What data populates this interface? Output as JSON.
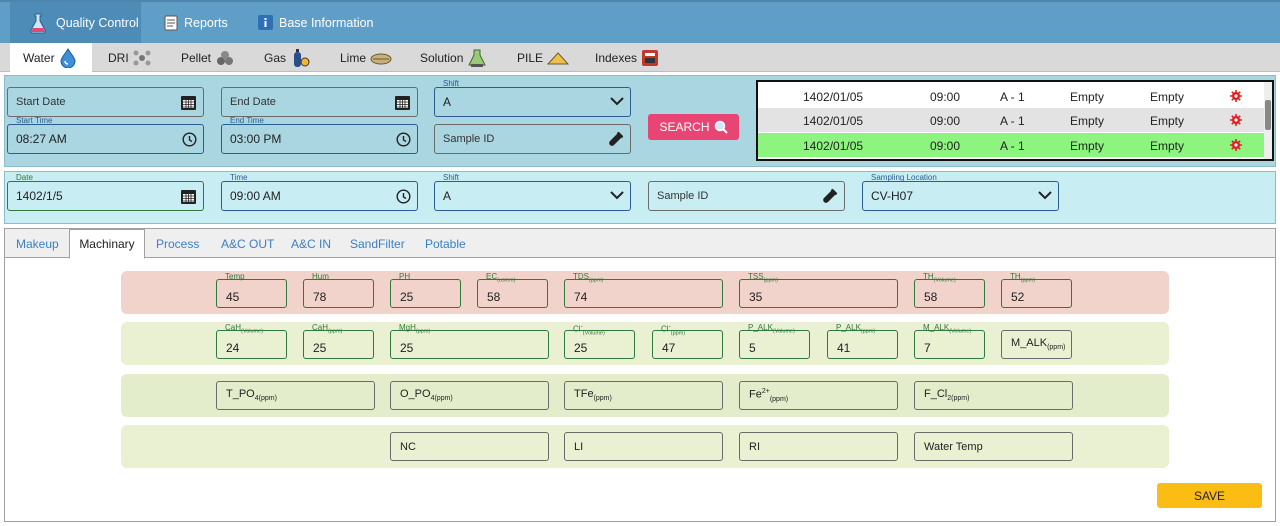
{
  "topnav": [
    {
      "label": "Quality Control",
      "icon": "flask-icon",
      "active": true
    },
    {
      "label": "Reports",
      "icon": "document-icon"
    },
    {
      "label": "Base Information",
      "icon": "info-icon"
    }
  ],
  "subtabs": [
    {
      "label": "Water",
      "icon": "water-drop-icon",
      "active": true
    },
    {
      "label": "DRI",
      "icon": "molecule-icon"
    },
    {
      "label": "Pellet",
      "icon": "pellet-icon"
    },
    {
      "label": "Gas",
      "icon": "gas-cylinder-icon"
    },
    {
      "label": "Lime",
      "icon": "lime-icon"
    },
    {
      "label": "Solution",
      "icon": "solution-icon"
    },
    {
      "label": "PILE",
      "icon": "pile-icon"
    },
    {
      "label": "Indexes",
      "icon": "indexes-icon"
    }
  ],
  "filter": {
    "start_date": {
      "placeholder": "Start Date"
    },
    "end_date": {
      "placeholder": "End Date"
    },
    "shift": {
      "label": "Shift",
      "value": "A"
    },
    "start_time": {
      "label": "Start Time",
      "value": "08:27 AM"
    },
    "end_time": {
      "label": "End Time",
      "value": "03:00 PM"
    },
    "sample_id": {
      "placeholder": "Sample ID"
    },
    "search_label": "SEARCH"
  },
  "results": [
    {
      "date": "1402/01/05",
      "time": "09:00",
      "shift": "A - 1",
      "c1": "Empty",
      "c2": "Empty"
    },
    {
      "date": "1402/01/05",
      "time": "09:00",
      "shift": "A - 1",
      "c1": "Empty",
      "c2": "Empty"
    },
    {
      "date": "1402/01/05",
      "time": "09:00",
      "shift": "A - 1",
      "c1": "Empty",
      "c2": "Empty",
      "selected": true
    }
  ],
  "entry": {
    "date": {
      "label": "Date",
      "value": "1402/1/5"
    },
    "time": {
      "label": "Time",
      "value": "09:00 AM"
    },
    "shift": {
      "label": "Shift",
      "value": "A"
    },
    "sample_id": {
      "placeholder": "Sample ID"
    },
    "location": {
      "label": "Sampling Location",
      "value": "CV-H07"
    }
  },
  "inner_tabs": [
    {
      "label": "Makeup"
    },
    {
      "label": "Machinary",
      "active": true
    },
    {
      "label": "Process"
    },
    {
      "label": "A&C OUT"
    },
    {
      "label": "A&C IN"
    },
    {
      "label": "SandFilter"
    },
    {
      "label": "Potable"
    }
  ],
  "measurements": {
    "temp": {
      "label": "Temp",
      "value": "45"
    },
    "hum": {
      "label": "Hum",
      "value": "78"
    },
    "ph": {
      "label": "PH",
      "value": "25"
    },
    "ec": {
      "label": "EC",
      "unit": "(us/cm)",
      "value": "58"
    },
    "tds": {
      "label": "TDS",
      "unit": "(ppm)",
      "value": "74"
    },
    "tss": {
      "label": "TSS",
      "unit": "(ppm)",
      "value": "35"
    },
    "th_vol": {
      "label": "TH",
      "unit": "(Volume)",
      "value": "58"
    },
    "th_ppm": {
      "label": "TH",
      "unit": "(ppm)",
      "value": "52"
    },
    "cah_vol": {
      "label": "CaH",
      "unit": "(Volume)",
      "value": "24"
    },
    "cah_ppm": {
      "label": "CaH",
      "unit": "(ppm)",
      "value": "25"
    },
    "mgh": {
      "label": "MgH",
      "unit": "(ppm)",
      "value": "25"
    },
    "cl_vol": {
      "label": "Cl",
      "unit": "(Volume)",
      "value": "25"
    },
    "cl_ppm": {
      "label": "Cl",
      "unit": "(ppm)",
      "value": "47"
    },
    "palk_vol": {
      "label": "P_ALK",
      "unit": "(Volume)",
      "value": "5"
    },
    "palk_ppm": {
      "label": "P_ALK",
      "unit": "(ppm)",
      "value": "41"
    },
    "malk_vol": {
      "label": "M_ALK",
      "unit": "(Volume)",
      "value": "7"
    },
    "malk_ppm": {
      "label": "M_ALK",
      "unit": "(ppm)"
    },
    "t_po4": {
      "label": "T_PO",
      "sub": "4(ppm)"
    },
    "o_po4": {
      "label": "O_PO",
      "sub": "4(ppm)"
    },
    "tfe": {
      "label": "TFe",
      "sub": "(ppm)"
    },
    "fe2": {
      "label": "Fe",
      "sup": "2+",
      "sub": "(ppm)"
    },
    "f_cl2": {
      "label": "F_Cl",
      "sub": "2(ppm)"
    },
    "nc": {
      "label": "NC"
    },
    "li": {
      "label": "LI"
    },
    "ri": {
      "label": "RI"
    },
    "water_temp": {
      "label": "Water Temp"
    }
  },
  "save_label": "SAVE",
  "colors": {
    "topbar": "#5f9fc7",
    "search": "#e84574",
    "save": "#fbbc14",
    "selected_row": "#8cf47f"
  }
}
